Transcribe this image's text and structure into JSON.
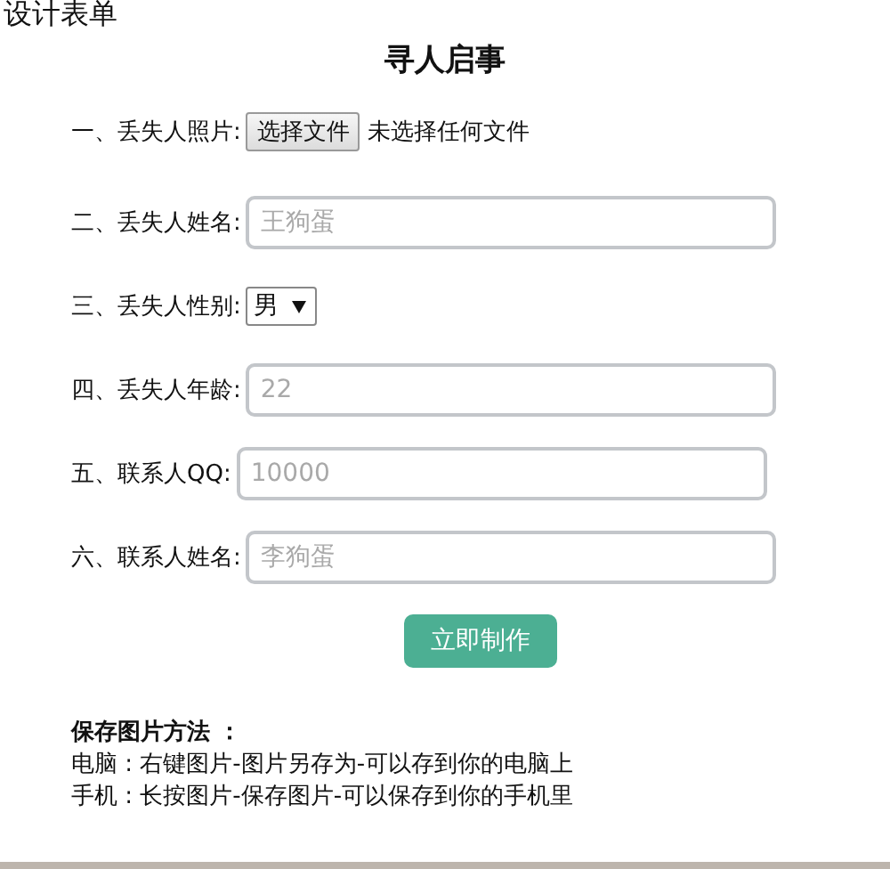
{
  "page_title": "设计表单",
  "heading": "寻人启事",
  "fields": [
    {
      "kind": "file",
      "label": "一、丢失人照片:",
      "button": "选择文件",
      "status": "未选择任何文件"
    },
    {
      "kind": "text",
      "label": "二、丢失人姓名:",
      "placeholder": "王狗蛋"
    },
    {
      "kind": "select",
      "label": "三、丢失人性别:",
      "value": "男"
    },
    {
      "kind": "text",
      "label": "四、丢失人年龄:",
      "placeholder": "22"
    },
    {
      "kind": "text",
      "label": "五、联系人QQ:",
      "placeholder": "10000"
    },
    {
      "kind": "text",
      "label": "六、联系人姓名:",
      "placeholder": "李狗蛋"
    }
  ],
  "submit": "立即制作",
  "help": {
    "title": "保存图片方法 ：",
    "lines": [
      "电脑 : 右键图片-图片另存为-可以存到你的电脑上",
      "手机 : 长按图片-保存图片-可以保存到你的手机里"
    ]
  }
}
